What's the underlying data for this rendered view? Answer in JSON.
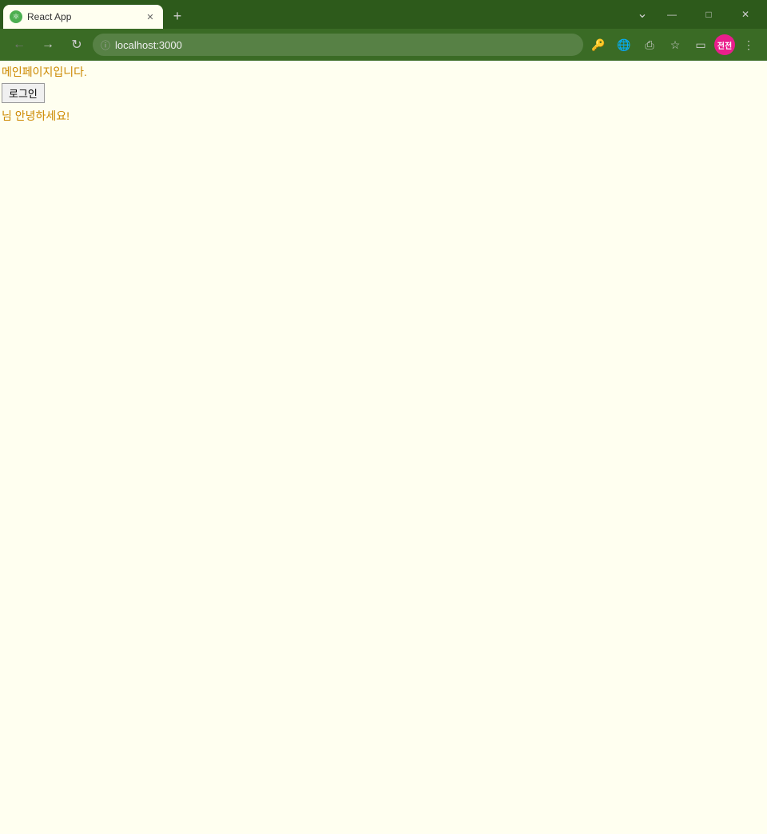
{
  "browser": {
    "tab": {
      "title": "React App",
      "favicon": "⚛"
    },
    "new_tab_icon": "+",
    "overflow_icon": "⌄",
    "window_controls": {
      "minimize": "—",
      "maximize": "□",
      "close": "✕"
    },
    "nav": {
      "back_icon": "←",
      "forward_icon": "→",
      "reload_icon": "↻",
      "address": "localhost:3000",
      "lock_icon": "🔒",
      "key_icon": "🔑",
      "translate_icon": "🌐",
      "share_icon": "⎙",
      "bookmark_icon": "☆",
      "sidebar_icon": "▭",
      "profile_label": "전전",
      "menu_icon": "⋮"
    }
  },
  "page": {
    "main_text": "메인페이지입니다.",
    "login_button_label": "로그인",
    "greeting_text": "님 안녕하세요!"
  }
}
